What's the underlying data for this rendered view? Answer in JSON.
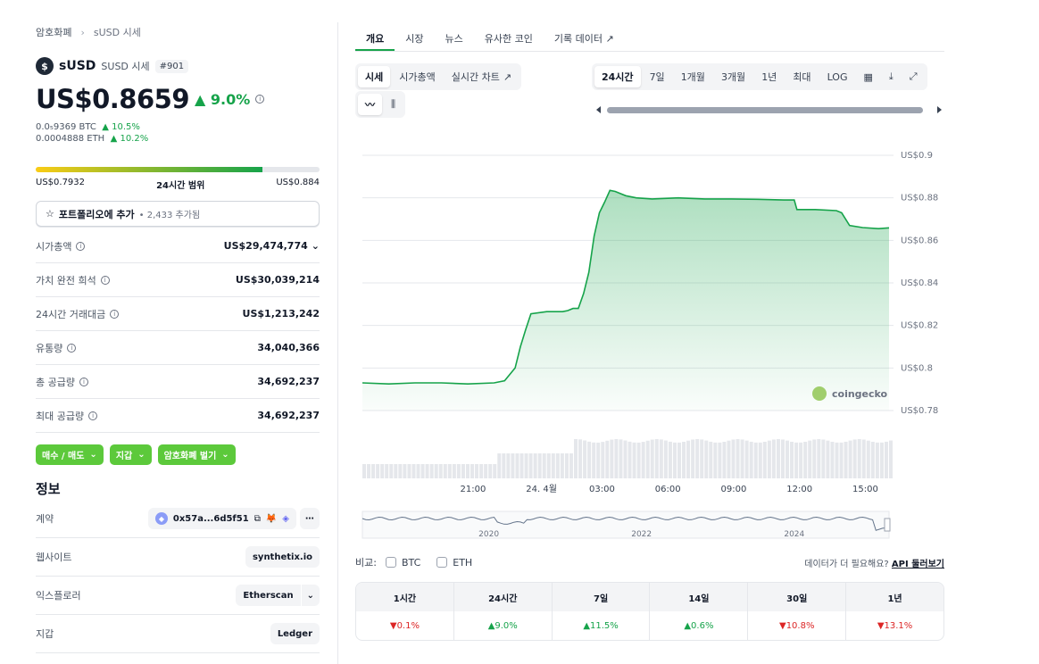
{
  "breadcrumb": {
    "root": "암호화폐",
    "current": "sUSD 시세"
  },
  "coin": {
    "name": "sUSD",
    "subtitle": "SUSD 시세",
    "rank": "#901"
  },
  "price": {
    "value": "US$0.8659",
    "change": "9.0%"
  },
  "btc_price": {
    "value": "0.0₅9369 BTC",
    "change": "10.5%"
  },
  "eth_price": {
    "value": "0.0004888 ETH",
    "change": "10.2%"
  },
  "range": {
    "low": "US$0.7932",
    "label": "24시간 범위",
    "high": "US$0.884",
    "position": 0.8
  },
  "portfolio": {
    "label": "포트폴리오에 추가",
    "count": "• 2,433 추가됨"
  },
  "stats": [
    {
      "key": "시가총액",
      "value": "US$29,474,774"
    },
    {
      "key": "가치 완전 희석",
      "value": "US$30,039,214"
    },
    {
      "key": "24시간 거래대금",
      "value": "US$1,213,242"
    },
    {
      "key": "유통량",
      "value": "34,040,366"
    },
    {
      "key": "총 공급량",
      "value": "34,692,237"
    },
    {
      "key": "최대 공급량",
      "value": "34,692,237"
    }
  ],
  "actions": {
    "buy_sell": "매수 / 매도",
    "wallet": "지갑",
    "earn": "암호화폐 벌기"
  },
  "info": {
    "title": "정보",
    "contract_label": "계약",
    "contract_value": "0x57a...6d5f51",
    "website_label": "웹사이트",
    "website_value": "synthetix.io",
    "explorer_label": "익스플로러",
    "explorer_value": "Etherscan",
    "wallet_label": "지갑",
    "wallet_value": "Ledger"
  },
  "tabs": [
    "개요",
    "시장",
    "뉴스",
    "유사한 코인",
    "기록 데이터"
  ],
  "chart_type_tabs": [
    "시세",
    "시가총액",
    "실시간 차트"
  ],
  "range_tabs": [
    "24시간",
    "7일",
    "1개월",
    "3개월",
    "1년",
    "최대",
    "LOG"
  ],
  "watermark": "coingecko",
  "compare": {
    "label": "비교:",
    "btc": "BTC",
    "eth": "ETH",
    "api_text": "데이터가 더 필요해요?",
    "api_link": "API 둘러보기"
  },
  "performance": [
    {
      "period": "1시간",
      "change": "0.1%",
      "dir": "down"
    },
    {
      "period": "24시간",
      "change": "9.0%",
      "dir": "up"
    },
    {
      "period": "7일",
      "change": "11.5%",
      "dir": "up"
    },
    {
      "period": "14일",
      "change": "0.6%",
      "dir": "up"
    },
    {
      "period": "30일",
      "change": "10.8%",
      "dir": "down"
    },
    {
      "period": "1년",
      "change": "13.1%",
      "dir": "down"
    }
  ],
  "chart_data": {
    "type": "area",
    "y_ticks": [
      "US$0.9",
      "US$0.88",
      "US$0.86",
      "US$0.84",
      "US$0.82",
      "US$0.8",
      "US$0.78"
    ],
    "x_ticks": [
      "21:00",
      "24. 4월",
      "03:00",
      "06:00",
      "09:00",
      "12:00",
      "15:00"
    ],
    "ylim": [
      0.78,
      0.9
    ],
    "series_points": [
      [
        0.0,
        0.793
      ],
      [
        0.05,
        0.7925
      ],
      [
        0.1,
        0.793
      ],
      [
        0.15,
        0.793
      ],
      [
        0.2,
        0.7925
      ],
      [
        0.25,
        0.793
      ],
      [
        0.27,
        0.794
      ],
      [
        0.29,
        0.8
      ],
      [
        0.3,
        0.81
      ],
      [
        0.31,
        0.818
      ],
      [
        0.32,
        0.8255
      ],
      [
        0.35,
        0.8265
      ],
      [
        0.38,
        0.8265
      ],
      [
        0.39,
        0.827
      ],
      [
        0.4,
        0.828
      ],
      [
        0.41,
        0.828
      ],
      [
        0.42,
        0.835
      ],
      [
        0.43,
        0.845
      ],
      [
        0.44,
        0.862
      ],
      [
        0.45,
        0.873
      ],
      [
        0.46,
        0.878
      ],
      [
        0.47,
        0.8835
      ],
      [
        0.48,
        0.883
      ],
      [
        0.5,
        0.881
      ],
      [
        0.52,
        0.88
      ],
      [
        0.55,
        0.8795
      ],
      [
        0.6,
        0.88
      ],
      [
        0.65,
        0.8795
      ],
      [
        0.7,
        0.8795
      ],
      [
        0.75,
        0.8793
      ],
      [
        0.8,
        0.879
      ],
      [
        0.82,
        0.879
      ],
      [
        0.825,
        0.8745
      ],
      [
        0.86,
        0.8745
      ],
      [
        0.9,
        0.874
      ],
      [
        0.91,
        0.873
      ],
      [
        0.925,
        0.867
      ],
      [
        0.95,
        0.866
      ],
      [
        0.98,
        0.8655
      ],
      [
        1.0,
        0.8659
      ]
    ],
    "nav_labels": [
      "2020",
      "2022",
      "2024"
    ]
  }
}
